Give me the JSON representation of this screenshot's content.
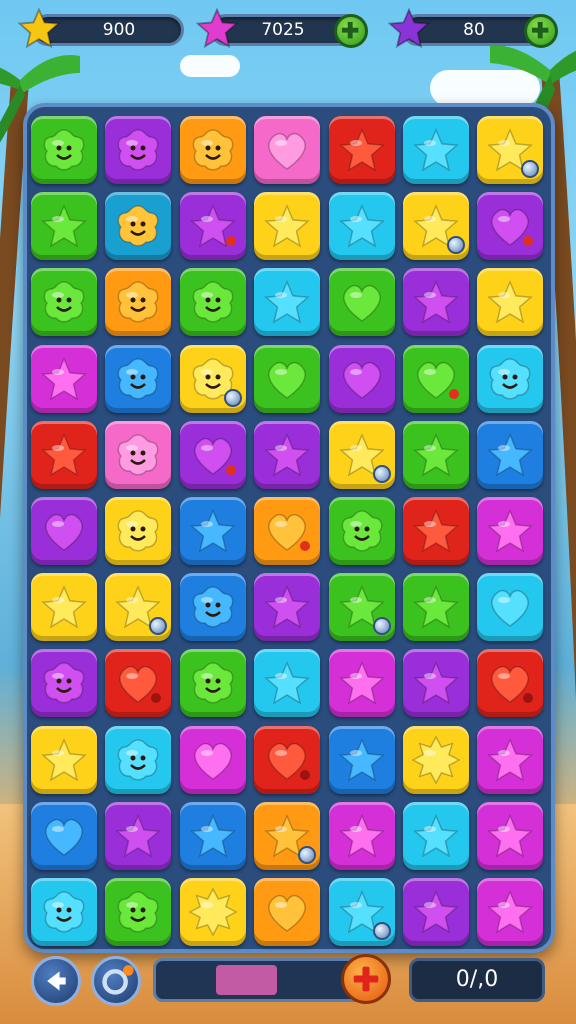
{
  "hud": {
    "meters": [
      {
        "name": "stars-counter",
        "value": "900",
        "star_color": "#f7c613",
        "has_plus": false
      },
      {
        "name": "pink-star-counter",
        "value": "7025",
        "star_color": "#e03ccf",
        "has_plus": true
      },
      {
        "name": "purple-star-counter",
        "value": "80",
        "star_color": "#8a33d6",
        "has_plus": true
      }
    ]
  },
  "board": {
    "rows": 11,
    "cols": 7,
    "tiles": [
      [
        {
          "bg": "green",
          "shape": "blob-face"
        },
        {
          "bg": "purple",
          "shape": "blob-face"
        },
        {
          "bg": "orange",
          "shape": "blob-face"
        },
        {
          "bg": "pink",
          "shape": "heart"
        },
        {
          "bg": "red",
          "shape": "star"
        },
        {
          "bg": "cyan",
          "shape": "star"
        },
        {
          "bg": "yellow",
          "shape": "star",
          "gem": true
        }
      ],
      [
        {
          "bg": "green",
          "shape": "star"
        },
        {
          "bg": "teal",
          "shape": "blob-face"
        },
        {
          "bg": "purple",
          "shape": "star",
          "dot": true
        },
        {
          "bg": "yellow",
          "shape": "star"
        },
        {
          "bg": "cyan",
          "shape": "star"
        },
        {
          "bg": "yellow",
          "shape": "star",
          "gem": true
        },
        {
          "bg": "purple",
          "shape": "heart",
          "dot": true
        }
      ],
      [
        {
          "bg": "green",
          "shape": "blob-face"
        },
        {
          "bg": "orange",
          "shape": "blob-face"
        },
        {
          "bg": "green",
          "shape": "blob-face"
        },
        {
          "bg": "cyan",
          "shape": "star"
        },
        {
          "bg": "green",
          "shape": "heart"
        },
        {
          "bg": "purple",
          "shape": "star"
        },
        {
          "bg": "yellow",
          "shape": "star"
        }
      ],
      [
        {
          "bg": "magenta",
          "shape": "star"
        },
        {
          "bg": "blue",
          "shape": "blob-face"
        },
        {
          "bg": "yellow",
          "shape": "blob-face",
          "gem": true
        },
        {
          "bg": "green",
          "shape": "heart"
        },
        {
          "bg": "purple",
          "shape": "heart"
        },
        {
          "bg": "green",
          "shape": "heart",
          "dot": true
        },
        {
          "bg": "cyan",
          "shape": "blob-face"
        }
      ],
      [
        {
          "bg": "red",
          "shape": "star"
        },
        {
          "bg": "pink",
          "shape": "blob-face"
        },
        {
          "bg": "purple",
          "shape": "heart",
          "dot": true
        },
        {
          "bg": "purple",
          "shape": "star"
        },
        {
          "bg": "yellow",
          "shape": "star",
          "gem": true
        },
        {
          "bg": "green",
          "shape": "star"
        },
        {
          "bg": "blue",
          "shape": "star"
        }
      ],
      [
        {
          "bg": "purple",
          "shape": "heart"
        },
        {
          "bg": "yellow",
          "shape": "blob-face"
        },
        {
          "bg": "blue",
          "shape": "star"
        },
        {
          "bg": "orange",
          "shape": "heart",
          "dot": true
        },
        {
          "bg": "green",
          "shape": "blob-face"
        },
        {
          "bg": "red",
          "shape": "star"
        },
        {
          "bg": "magenta",
          "shape": "star"
        }
      ],
      [
        {
          "bg": "yellow",
          "shape": "star"
        },
        {
          "bg": "yellow",
          "shape": "star",
          "gem": true
        },
        {
          "bg": "blue",
          "shape": "blob-face"
        },
        {
          "bg": "purple",
          "shape": "star"
        },
        {
          "bg": "green",
          "shape": "star",
          "gem": true
        },
        {
          "bg": "green",
          "shape": "star"
        },
        {
          "bg": "cyan",
          "shape": "heart"
        }
      ],
      [
        {
          "bg": "purple",
          "shape": "blob-face"
        },
        {
          "bg": "red",
          "shape": "heart",
          "dot": true
        },
        {
          "bg": "green",
          "shape": "blob-face"
        },
        {
          "bg": "cyan",
          "shape": "star"
        },
        {
          "bg": "magenta",
          "shape": "star"
        },
        {
          "bg": "purple",
          "shape": "star"
        },
        {
          "bg": "red",
          "shape": "heart",
          "dot": true
        }
      ],
      [
        {
          "bg": "yellow",
          "shape": "star"
        },
        {
          "bg": "cyan",
          "shape": "blob-face"
        },
        {
          "bg": "magenta",
          "shape": "heart"
        },
        {
          "bg": "red",
          "shape": "heart",
          "dot": true
        },
        {
          "bg": "blue",
          "shape": "star"
        },
        {
          "bg": "yellow",
          "shape": "burst"
        },
        {
          "bg": "magenta",
          "shape": "star"
        }
      ],
      [
        {
          "bg": "blue",
          "shape": "heart"
        },
        {
          "bg": "purple",
          "shape": "star"
        },
        {
          "bg": "blue",
          "shape": "star"
        },
        {
          "bg": "orange",
          "shape": "star",
          "gem": true
        },
        {
          "bg": "magenta",
          "shape": "star"
        },
        {
          "bg": "cyan",
          "shape": "star"
        },
        {
          "bg": "magenta",
          "shape": "star"
        }
      ],
      [
        {
          "bg": "cyan",
          "shape": "blob-face"
        },
        {
          "bg": "green",
          "shape": "blob-face"
        },
        {
          "bg": "yellow",
          "shape": "burst"
        },
        {
          "bg": "orange",
          "shape": "heart"
        },
        {
          "bg": "cyan",
          "shape": "star",
          "gem": true
        },
        {
          "bg": "purple",
          "shape": "star"
        },
        {
          "bg": "magenta",
          "shape": "star"
        }
      ]
    ]
  },
  "palette": {
    "green": {
      "bg": "#3cc21f",
      "fg": "#6be83c"
    },
    "purple": {
      "bg": "#9a2fd9",
      "fg": "#d04ff0"
    },
    "orange": {
      "bg": "#ff9a12",
      "fg": "#ffc23a"
    },
    "pink": {
      "bg": "#f56ac8",
      "fg": "#ff9be0"
    },
    "red": {
      "bg": "#e0241c",
      "fg": "#ff5a3d"
    },
    "cyan": {
      "bg": "#24c7ee",
      "fg": "#56e0ff"
    },
    "yellow": {
      "bg": "#ffd21a",
      "fg": "#ffea5c"
    },
    "teal": {
      "bg": "#1a9fd1",
      "fg": "#ffc43a"
    },
    "blue": {
      "bg": "#1f7fe0",
      "fg": "#46b8ff"
    },
    "magenta": {
      "bg": "#d52fd8",
      "fg": "#ff70f0"
    }
  },
  "bottom_bar": {
    "counter_text": "0/,0",
    "progress_fraction": 0.55,
    "progress_color": "#c35aa4"
  }
}
